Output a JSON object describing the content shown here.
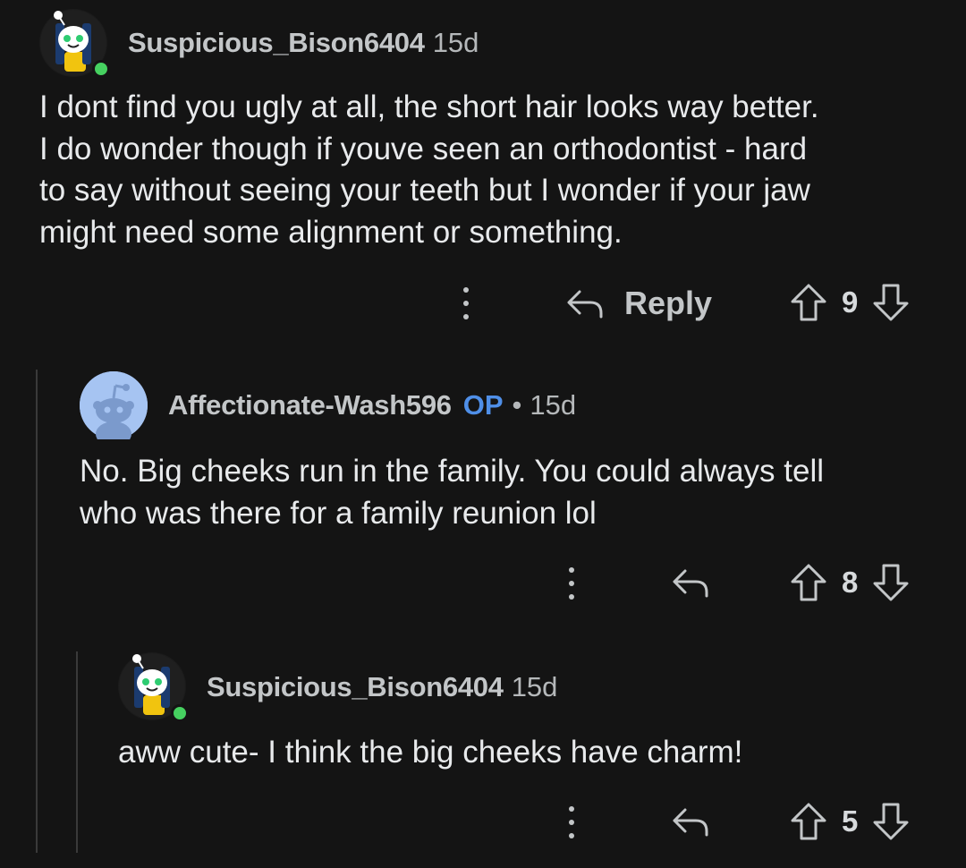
{
  "comments": [
    {
      "username": "Suspicious_Bison6404",
      "age": "15d",
      "body": [
        "I dont find you ugly at all, the short hair looks way better.",
        "I do wonder though if youve seen an orthodontist - hard",
        "to say without seeing your teeth but I wonder if your jaw",
        "might need some alignment or something."
      ],
      "reply_label": "Reply",
      "score": "9",
      "online": true
    },
    {
      "username": "Affectionate-Wash596",
      "op_badge": "OP",
      "separator": "•",
      "age": "15d",
      "body": [
        "No. Big cheeks run in the family. You could always tell",
        "who was there for a family reunion lol"
      ],
      "score": "8"
    },
    {
      "username": "Suspicious_Bison6404",
      "age": "15d",
      "body": [
        "aww cute- I think the big cheeks have charm!"
      ],
      "score": "5",
      "online": true
    }
  ],
  "colors": {
    "background": "#141414",
    "op_badge": "#4f8fe8",
    "online": "#46d160",
    "thread_line": "#3a3a3a"
  },
  "icons": [
    "more-options-icon",
    "reply-arrow-icon",
    "upvote-arrow-icon",
    "downvote-arrow-icon",
    "snoo-avatar-icon"
  ]
}
